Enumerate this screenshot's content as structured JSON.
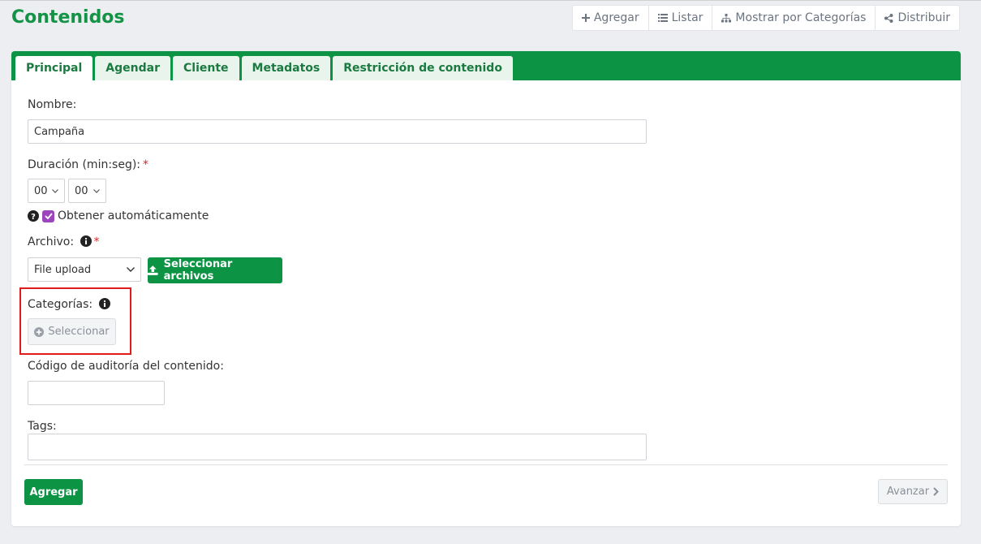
{
  "header": {
    "title": "Contenidos",
    "actions": [
      {
        "label": "Agregar",
        "icon": "plus-icon"
      },
      {
        "label": "Listar",
        "icon": "list-icon"
      },
      {
        "label": "Mostrar por Categorías",
        "icon": "sitemap-icon"
      },
      {
        "label": "Distribuir",
        "icon": "share-icon"
      }
    ]
  },
  "tabs": [
    {
      "label": "Principal",
      "active": true
    },
    {
      "label": "Agendar",
      "active": false
    },
    {
      "label": "Cliente",
      "active": false
    },
    {
      "label": "Metadatos",
      "active": false
    },
    {
      "label": "Restricción de contenido",
      "active": false
    }
  ],
  "form": {
    "nombre_label": "Nombre:",
    "nombre_value": "Campaña",
    "duracion_label": "Duración (min:seg):",
    "required_mark": "*",
    "duracion_min": "00",
    "duracion_seg": "00",
    "auto_label": "Obtener automáticamente",
    "auto_checked": true,
    "archivo_label": "Archivo:",
    "archivo_type": "File upload",
    "select_files_label": "Seleccionar archivos",
    "categorias_label": "Categorías:",
    "seleccionar_label": "Seleccionar",
    "codigo_label": "Código de auditoría del contenido:",
    "codigo_value": "",
    "tags_label": "Tags:",
    "tags_value": ""
  },
  "footer": {
    "agregar_label": "Agregar",
    "avanzar_label": "Avanzar"
  },
  "colors": {
    "brand_green": "#0c9444",
    "title_green": "#149347",
    "checkbox_purple": "#9c45bd",
    "highlight_red": "#e01b1b",
    "required_red": "#e02424"
  }
}
